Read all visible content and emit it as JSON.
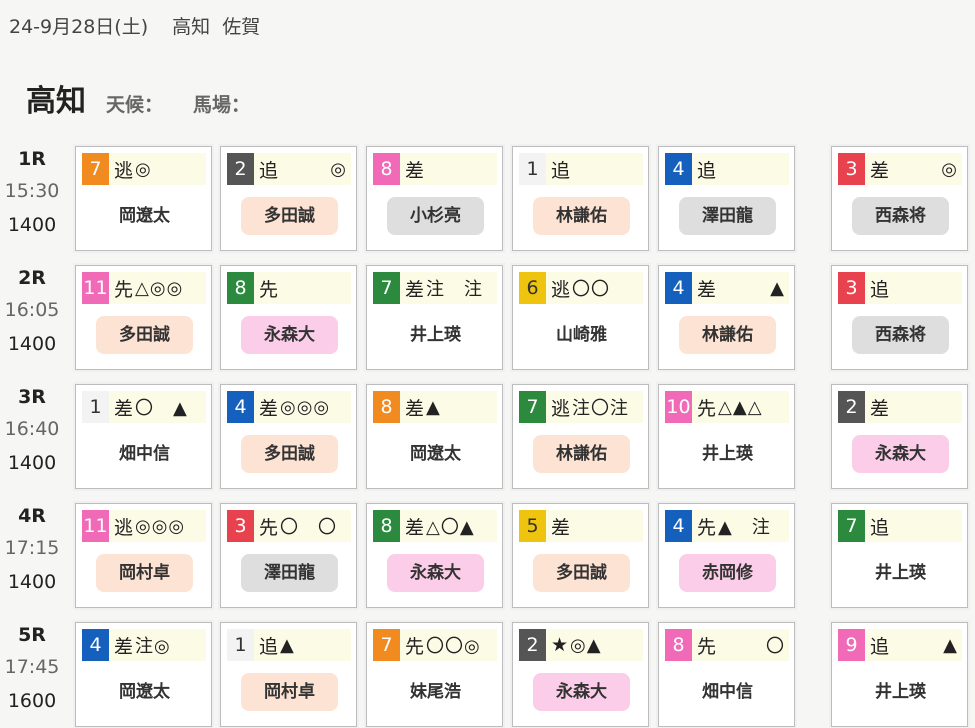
{
  "header": {
    "date": "24-9月28日(土)",
    "track1": "高知",
    "track2": "佐賀"
  },
  "venue": {
    "name": "高知",
    "weather_label": "天候：",
    "going_label": "馬場："
  },
  "races": [
    {
      "no": "1R",
      "time": "15:30",
      "distance": "1400",
      "picks": [
        {
          "num": "7",
          "color": "w7",
          "style": "逃",
          "marks": "◎",
          "align": "left",
          "jockey": "岡遼太",
          "tag": "plain"
        },
        {
          "num": "2",
          "color": "w2",
          "style": "追",
          "marks": "◎",
          "align": "right",
          "jockey": "多田誠",
          "tag": "peach"
        },
        {
          "num": "8",
          "color": "w8",
          "style": "差",
          "marks": "",
          "align": "left",
          "jockey": "小杉亮",
          "tag": "gray"
        },
        {
          "num": "1",
          "color": "w1",
          "style": "追",
          "marks": "",
          "align": "left",
          "jockey": "林謙佑",
          "tag": "peach"
        },
        {
          "num": "4",
          "color": "w4",
          "style": "追",
          "marks": "",
          "align": "left",
          "jockey": "澤田龍",
          "tag": "gray"
        },
        {
          "num": "3",
          "color": "w3",
          "style": "差",
          "marks": "◎",
          "align": "right",
          "jockey": "西森将",
          "tag": "gray"
        }
      ]
    },
    {
      "no": "2R",
      "time": "16:05",
      "distance": "1400",
      "picks": [
        {
          "num": "11",
          "color": "w11",
          "style": "先",
          "marks": "△◎◎",
          "align": "left",
          "jockey": "多田誠",
          "tag": "peach"
        },
        {
          "num": "8",
          "color": "g8",
          "style": "先",
          "marks": "",
          "align": "left",
          "jockey": "永森大",
          "tag": "pink"
        },
        {
          "num": "7",
          "color": "g7",
          "style": "差",
          "marks": "注　注",
          "align": "left",
          "jockey": "井上瑛",
          "tag": "plain"
        },
        {
          "num": "6",
          "color": "w6",
          "style": "逃",
          "marks": "〇〇",
          "align": "left",
          "jockey": "山崎雅",
          "tag": "plain"
        },
        {
          "num": "4",
          "color": "w4",
          "style": "差",
          "marks": "▲",
          "align": "right",
          "jockey": "林謙佑",
          "tag": "peach"
        },
        {
          "num": "3",
          "color": "w3",
          "style": "追",
          "marks": "",
          "align": "left",
          "jockey": "西森将",
          "tag": "gray"
        }
      ]
    },
    {
      "no": "3R",
      "time": "16:40",
      "distance": "1400",
      "picks": [
        {
          "num": "1",
          "color": "w1",
          "style": "差",
          "marks": "〇　▲",
          "align": "left",
          "jockey": "畑中信",
          "tag": "plain"
        },
        {
          "num": "4",
          "color": "w4",
          "style": "差",
          "marks": "◎◎◎",
          "align": "left",
          "jockey": "多田誠",
          "tag": "peach"
        },
        {
          "num": "8",
          "color": "w7",
          "style": "差",
          "marks": "▲",
          "align": "left",
          "jockey": "岡遼太",
          "tag": "plain"
        },
        {
          "num": "7",
          "color": "g7",
          "style": "逃",
          "marks": "注〇注",
          "align": "left",
          "jockey": "林謙佑",
          "tag": "peach"
        },
        {
          "num": "10",
          "color": "w10",
          "style": "先",
          "marks": "△▲△",
          "align": "left",
          "jockey": "井上瑛",
          "tag": "plain"
        },
        {
          "num": "2",
          "color": "w2",
          "style": "差",
          "marks": "",
          "align": "left",
          "jockey": "永森大",
          "tag": "pink"
        }
      ]
    },
    {
      "no": "4R",
      "time": "17:15",
      "distance": "1400",
      "picks": [
        {
          "num": "11",
          "color": "w11",
          "style": "逃",
          "marks": "◎◎◎",
          "align": "left",
          "jockey": "岡村卓",
          "tag": "peach"
        },
        {
          "num": "3",
          "color": "w3",
          "style": "先",
          "marks": "〇　〇",
          "align": "left",
          "jockey": "澤田龍",
          "tag": "gray"
        },
        {
          "num": "8",
          "color": "g8",
          "style": "差",
          "marks": "△〇▲",
          "align": "left",
          "jockey": "永森大",
          "tag": "pink"
        },
        {
          "num": "5",
          "color": "w5",
          "style": "差",
          "marks": "",
          "align": "left",
          "jockey": "多田誠",
          "tag": "peach"
        },
        {
          "num": "4",
          "color": "w4",
          "style": "先",
          "marks": "▲　注",
          "align": "left",
          "jockey": "赤岡修",
          "tag": "pink"
        },
        {
          "num": "7",
          "color": "g7",
          "style": "追",
          "marks": "",
          "align": "left",
          "jockey": "井上瑛",
          "tag": "plain"
        }
      ]
    },
    {
      "no": "5R",
      "time": "17:45",
      "distance": "1600",
      "picks": [
        {
          "num": "4",
          "color": "w4",
          "style": "差",
          "marks": "注◎",
          "align": "left",
          "jockey": "岡遼太",
          "tag": "plain"
        },
        {
          "num": "1",
          "color": "w1",
          "style": "追",
          "marks": "▲",
          "align": "left",
          "jockey": "岡村卓",
          "tag": "peach"
        },
        {
          "num": "7",
          "color": "w7",
          "style": "先",
          "marks": "〇〇◎",
          "align": "left",
          "jockey": "妹尾浩",
          "tag": "plain"
        },
        {
          "num": "2",
          "color": "w2",
          "style": "★",
          "marks": "◎▲",
          "align": "left",
          "jockey": "永森大",
          "tag": "pink"
        },
        {
          "num": "8",
          "color": "w8",
          "style": "先",
          "marks": "〇",
          "align": "right",
          "jockey": "畑中信",
          "tag": "plain"
        },
        {
          "num": "9",
          "color": "w9",
          "style": "追",
          "marks": "▲",
          "align": "right",
          "jockey": "井上瑛",
          "tag": "plain"
        }
      ]
    }
  ]
}
